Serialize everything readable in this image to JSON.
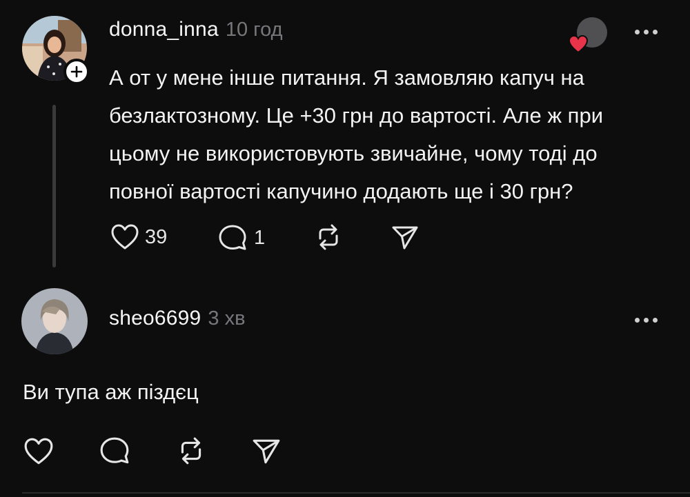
{
  "posts": [
    {
      "username": "donna_inna",
      "timestamp": "10 год",
      "text": "А от у мене інше питання. Я замовляю капуч на\nбезлактозному. Це +30 грн до вартості. Але ж при\nцьому не використовують звичайне, чому тоді до\nповної вартості капучино додають ще і 30 грн?",
      "likes": "39",
      "replies": "1",
      "avatar_icon": "user-avatar-woman",
      "follow_icon": "plus-icon",
      "liked_by_icon": "heart-filled-icon"
    },
    {
      "username": "sheo6699",
      "timestamp": "3 хв",
      "text": "Ви тупа аж піздєц",
      "avatar_icon": "user-avatar-anime"
    }
  ],
  "actions": [
    "heart-icon",
    "comment-icon",
    "repost-icon",
    "share-icon"
  ],
  "colors": {
    "background": "#0d0d0e",
    "text": "#f3f3f3",
    "muted": "#77777b",
    "like_red": "#e8344a",
    "thread_line": "#3a3a3c"
  }
}
